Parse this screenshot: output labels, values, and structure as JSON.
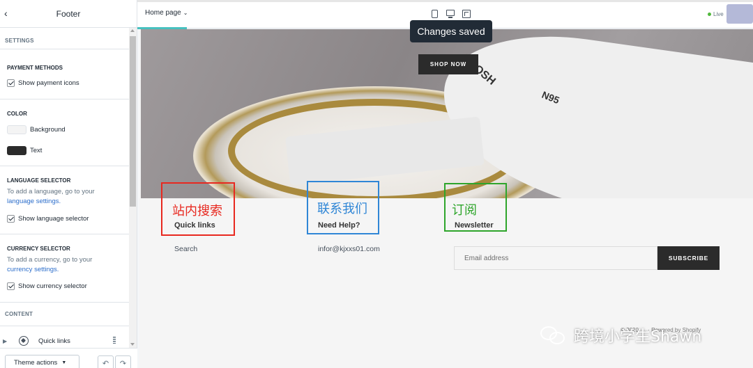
{
  "sidebar": {
    "title": "Footer",
    "back_icon": "chevron-left-icon",
    "settings_label": "SETTINGS",
    "payment": {
      "title": "PAYMENT METHODS",
      "checkbox_label": "Show payment icons"
    },
    "color": {
      "title": "COLOR",
      "background_label": "Background",
      "background_color": "#f4f4f4",
      "text_label": "Text",
      "text_color": "#2b2b2b"
    },
    "language": {
      "title": "LANGUAGE SELECTOR",
      "help_prefix": "To add a language, go to your",
      "help_link": "language settings.",
      "checkbox_label": "Show language selector"
    },
    "currency": {
      "title": "CURRENCY SELECTOR",
      "help_prefix": "To add a currency, go to your",
      "help_link": "currency settings.",
      "checkbox_label": "Show currency selector"
    },
    "content_label": "CONTENT",
    "quick_links_label": "Quick links",
    "theme_actions_label": "Theme actions",
    "undo_icon": "undo-icon",
    "redo_icon": "redo-icon"
  },
  "topbar": {
    "page_select": "Home page",
    "devices": [
      "mobile-icon",
      "desktop-icon",
      "fullscreen-icon"
    ],
    "live_label": "Live",
    "accent": "#47c1bf"
  },
  "toast": {
    "text": "Changes saved"
  },
  "preview": {
    "shop_now": "SHOP NOW",
    "mask_text_1": "N95",
    "mask_text_2": "DNOSH",
    "columns": [
      {
        "annotation": "站内搜索",
        "heading": "Quick links",
        "link": "Search"
      },
      {
        "annotation": "联系我们",
        "heading": "Need Help?",
        "link": "infor@kjxxs01.com"
      },
      {
        "annotation": "订阅",
        "heading": "Newsletter"
      }
    ],
    "email_placeholder": "Email address",
    "subscribe_label": "SUBSCRIBE",
    "footer_small": "© 2020, ... · Powered by Shopify"
  },
  "watermark": {
    "text": "跨境小学生Shawn"
  }
}
